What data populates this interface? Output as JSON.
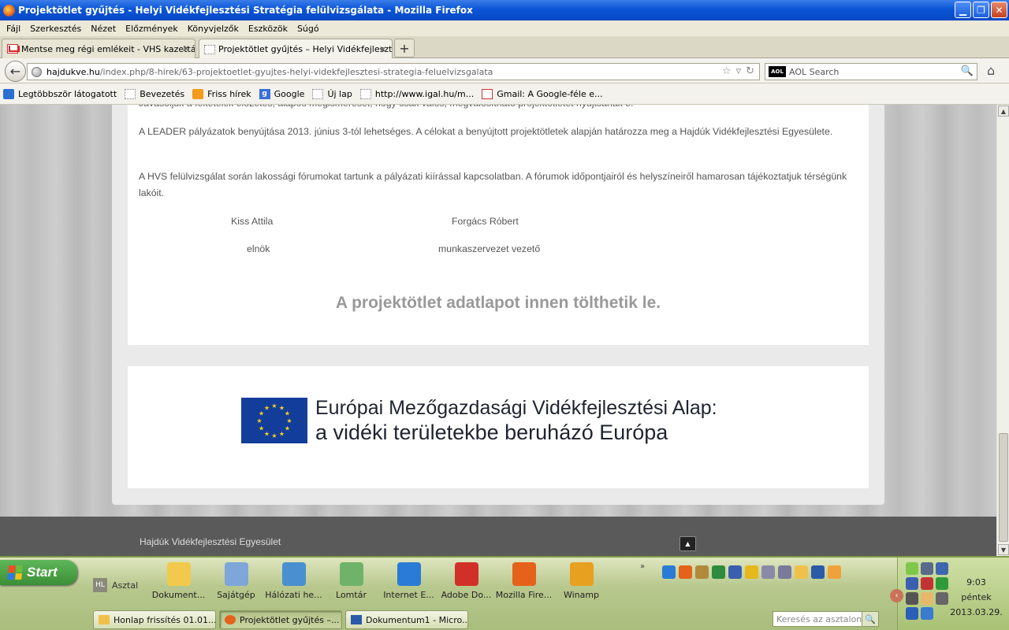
{
  "window": {
    "title": "Projektötlet gyűjtés - Helyi Vidékfejlesztési Stratégia felülvizsgálata - Mozilla Firefox",
    "minimize": "▁",
    "maximize": "❐",
    "close": "✕"
  },
  "menu": [
    "Fájl",
    "Szerkesztés",
    "Nézet",
    "Előzmények",
    "Könyvjelzők",
    "Eszközök",
    "Súgó"
  ],
  "tabs": [
    {
      "label": "Mentse meg régi emlékeit - VHS kazettár...",
      "close": "✕",
      "icon": "gmail-icon"
    },
    {
      "label": "Projektötlet gyűjtés – Helyi Vidékfejleszt...",
      "close": "✕",
      "icon": "blank-page-icon"
    }
  ],
  "newtab": "+",
  "nav": {
    "back": "←",
    "url_host": "hajdukve.hu",
    "url_path": "/index.php/8-hirek/63-projektoetlet-gyujtes-helyi-videkfejlesztesi-strategia-feluelvizsgalata",
    "star": "☆",
    "dropdown": "▿",
    "reload": "↻",
    "search_placeholder": "AOL Search",
    "search_engine": "AOL",
    "home": "⌂"
  },
  "bookmarks": [
    {
      "label": "Legtöbbször látogatott",
      "icon": "most-visited-icon"
    },
    {
      "label": "Bevezetés",
      "icon": "blank-page-icon"
    },
    {
      "label": "Friss hírek",
      "icon": "rss-icon"
    },
    {
      "label": "Google",
      "icon": "google-icon"
    },
    {
      "label": "Új lap",
      "icon": "blank-page-icon"
    },
    {
      "label": "http://www.igal.hu/m...",
      "icon": "blank-page-icon"
    },
    {
      "label": "Gmail: A Google-féle e...",
      "icon": "gmail-icon"
    }
  ],
  "article": {
    "cut_line": "Javasoljuk a feltételek előzetes, alapos megismerését, hogy csak valós, megvalósítható projektötletet nyújtsanak e.",
    "p1": "A LEADER pályázatok benyújtása 2013. június 3-tól lehetséges. A célokat a benyújtott projektötletek alapján határozza meg a Hajdúk Vidékfejlesztési Egyesülete.",
    "p2": "A HVS felülvizsgálat során lakossági fórumokat tartunk a pályázati kiírással kapcsolatban. A fórumok időpontjairól és helyszíneiről hamarosan tájékoztatjuk térségünk lakóit.",
    "sig1_name": "Kiss Attila",
    "sig1_role": "elnök",
    "sig2_name": "Forgács Róbert",
    "sig2_role": "munkaszervezet vezető",
    "download": "A projektötlet adatlapot innen tölthetik le."
  },
  "eu_banner": {
    "line1": "Európai Mezőgazdasági Vidékfejlesztési Alap:",
    "line2": "a vidéki területekbe beruházó Európa",
    "flag_color": "#133d9b",
    "star_color": "#f7d117"
  },
  "footer": {
    "name": "Hajdúk Vidékfejlesztési Egyesület",
    "totop": "▲"
  },
  "taskbar": {
    "start": "Start",
    "hl": "HL",
    "asztal": "Asztal",
    "more": "»",
    "desktop_icons": [
      {
        "label": "Dokument...",
        "icon": "documents-folder-icon",
        "color": "#f2c94c"
      },
      {
        "label": "Sajátgép",
        "icon": "my-computer-icon",
        "color": "#7ea6d8"
      },
      {
        "label": "Hálózati he...",
        "icon": "network-icon",
        "color": "#4a8fd0"
      },
      {
        "label": "Lomtár",
        "icon": "recycle-bin-icon",
        "color": "#6fb36a"
      },
      {
        "label": "Internet E...",
        "icon": "internet-explorer-icon",
        "color": "#2a7bd6"
      },
      {
        "label": "Adobe Do...",
        "icon": "adobe-icon",
        "color": "#d03028"
      },
      {
        "label": "Mozilla Fire...",
        "icon": "firefox-icon",
        "color": "#e5621a"
      },
      {
        "label": "Winamp",
        "icon": "winamp-icon",
        "color": "#e8a020"
      }
    ],
    "tasks": [
      {
        "label": "Honlap frissítés 01.01....",
        "icon": "folder-icon",
        "active": false
      },
      {
        "label": "Projektötlet gyűjtés –...",
        "icon": "firefox-icon",
        "active": true
      },
      {
        "label": "Dokumentum1 - Micro...",
        "icon": "word-icon",
        "active": false
      }
    ],
    "desk_search_placeholder": "Keresés az asztalon",
    "clock_time": "9:03",
    "clock_day": "péntek",
    "clock_date": "2013.03.29."
  },
  "colors": {
    "accent": "#0a55d6",
    "footer_bg": "#5a5a5a",
    "taskbar_bg": "#b8c88e"
  }
}
